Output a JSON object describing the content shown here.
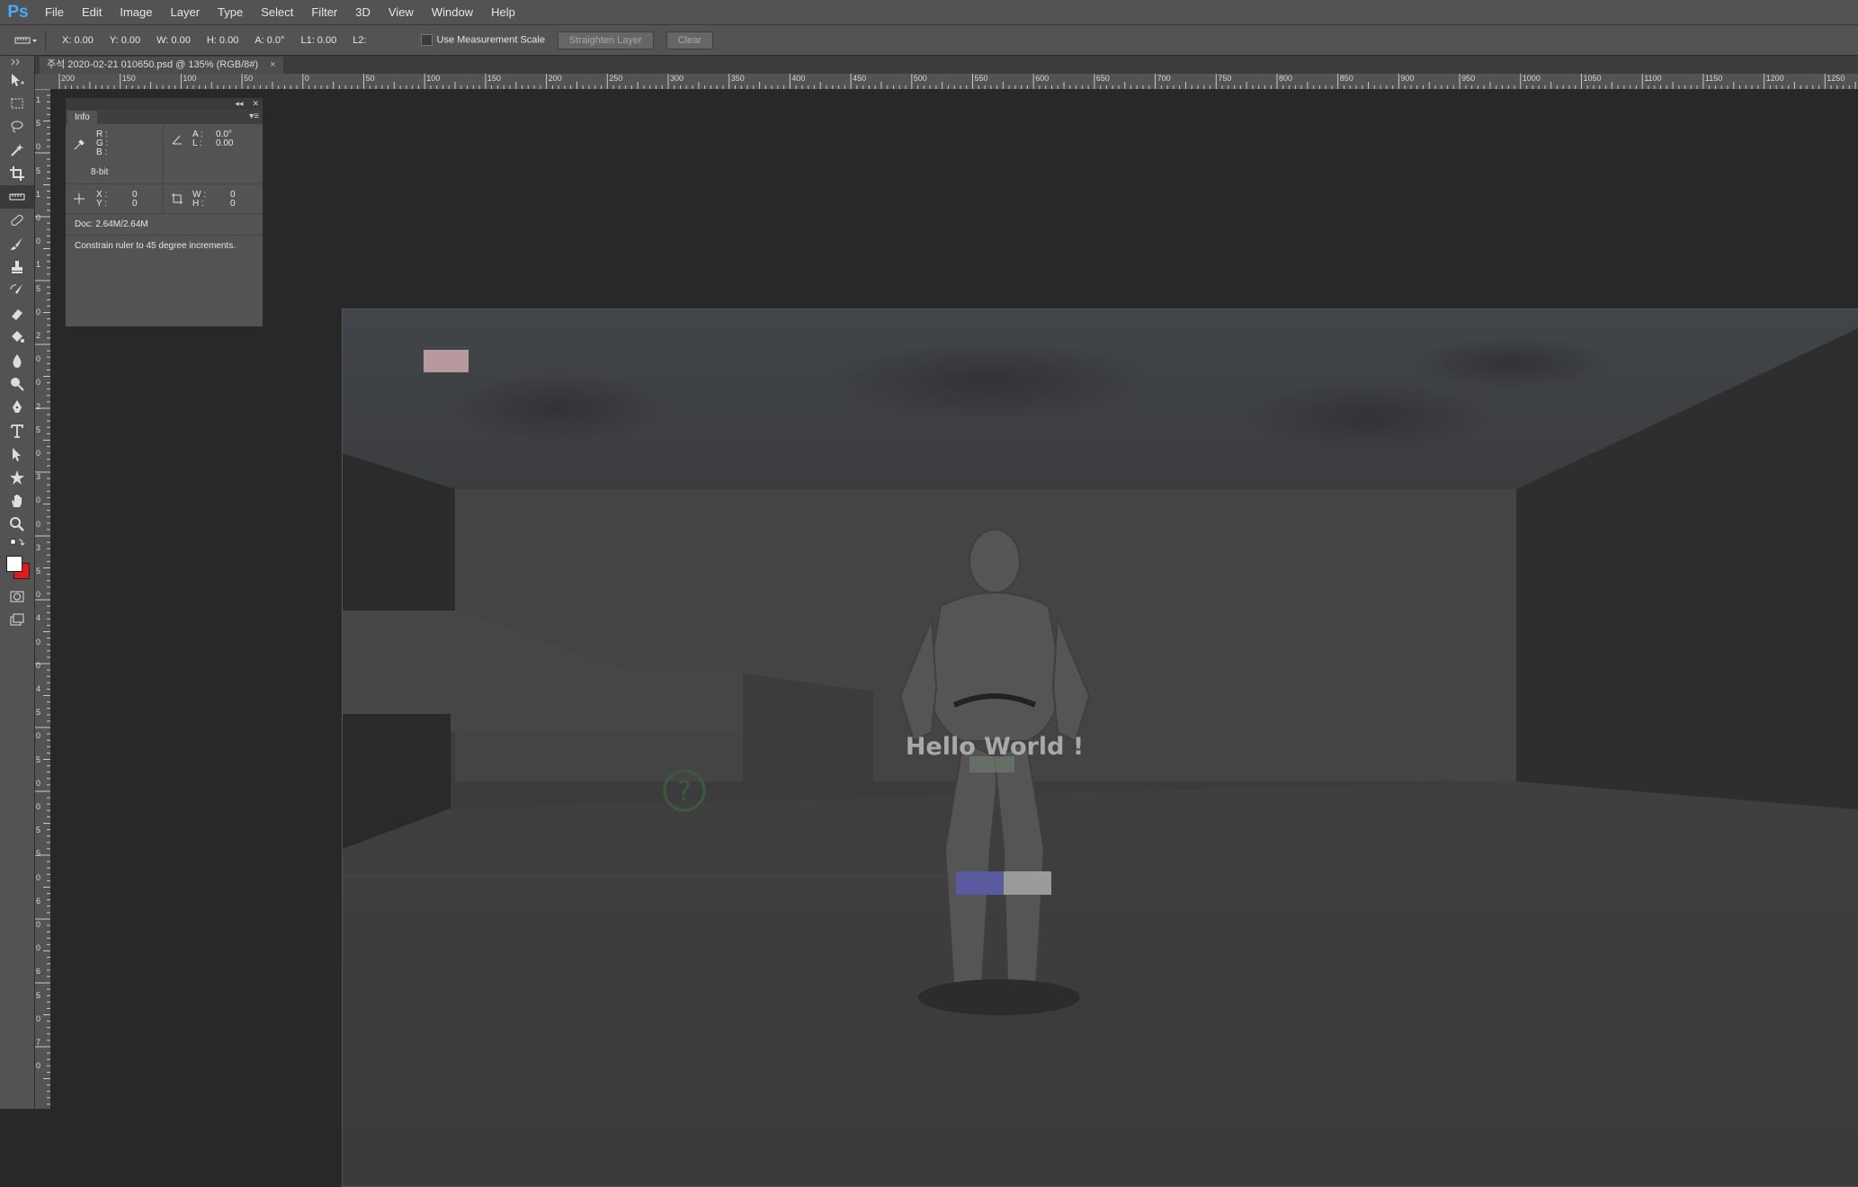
{
  "app": {
    "logo": "Ps",
    "menu": [
      "File",
      "Edit",
      "Image",
      "Layer",
      "Type",
      "Select",
      "Filter",
      "3D",
      "View",
      "Window",
      "Help"
    ]
  },
  "options": {
    "x": "X: 0.00",
    "y": "Y: 0.00",
    "w": "W: 0.00",
    "h": "H: 0.00",
    "a": "A: 0.0°",
    "l1": "L1: 0.00",
    "l2": "L2:",
    "use_measurement_scale": "Use Measurement Scale",
    "straighten_layer": "Straighten Layer",
    "clear": "Clear"
  },
  "document": {
    "tab_title": "주석 2020-02-21 010650.psd @ 135% (RGB/8#)",
    "close": "×",
    "scene_text": "Hello World !",
    "help_glyph": "?"
  },
  "rulers": {
    "h": [
      "200",
      "150",
      "100",
      "50",
      "0",
      "50",
      "100",
      "150",
      "200",
      "250",
      "300",
      "350",
      "400",
      "450",
      "500",
      "550",
      "600",
      "650",
      "700",
      "750",
      "800",
      "850",
      "900",
      "950",
      "1000",
      "1050",
      "1100",
      "1150",
      "1200",
      "1250"
    ],
    "v": [
      "1",
      "5",
      "0",
      "5",
      "1",
      "0",
      "0",
      "1",
      "5",
      "0",
      "2",
      "0",
      "0",
      "2",
      "5",
      "0",
      "3",
      "0",
      "0",
      "3",
      "5",
      "0",
      "4",
      "0",
      "0",
      "4",
      "5",
      "0",
      "5",
      "0",
      "0",
      "5",
      "5",
      "0",
      "6",
      "0",
      "0",
      "6",
      "5",
      "0",
      "7",
      "0"
    ]
  },
  "info_panel": {
    "tab": "Info",
    "collapse": "◂◂",
    "close": "✕",
    "menu": "▾≡",
    "r": "R :",
    "g": "G :",
    "b": "B :",
    "bit_depth": "8-bit",
    "a_label": "A :",
    "a_value": "0.0°",
    "l_label": "L :",
    "l_value": "0.00",
    "x_label": "X :",
    "x_value": "0",
    "y_label": "Y :",
    "y_value": "0",
    "w_label": "W :",
    "w_value": "0",
    "h_label": "H :",
    "h_value": "0",
    "doc": "Doc: 2.64M/2.64M",
    "hint": "Constrain ruler to 45 degree increments."
  },
  "colors": {
    "accent": "#4aa8ff",
    "foreground": "#ffffff",
    "background": "#e01b1b"
  }
}
